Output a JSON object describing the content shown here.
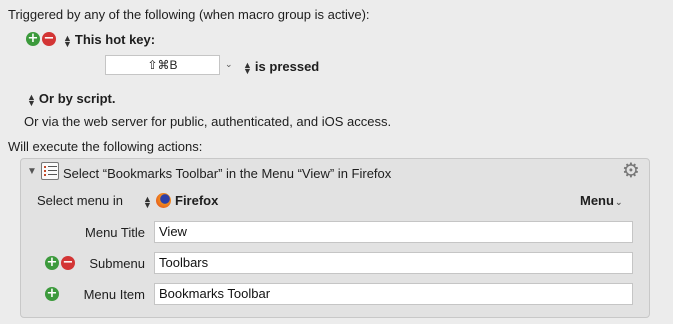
{
  "trigger": {
    "heading": "Triggered by any of the following (when macro group is active):",
    "hotkey_label": "This hot key:",
    "hotkey_value": "⇧⌘B",
    "hotkey_state": "is pressed",
    "script_label": "Or by script.",
    "web_server_text": "Or via the web server for public, authenticated, and iOS access."
  },
  "actions": {
    "heading": "Will execute the following actions:",
    "action_title": "Select “Bookmarks Toolbar” in the Menu “View” in Firefox",
    "select_menu_label": "Select menu in",
    "app_name": "Firefox",
    "menu_button": "Menu",
    "fields": {
      "menu_title_label": "Menu Title",
      "menu_title_value": "View",
      "submenu_label": "Submenu",
      "submenu_value": "Toolbars",
      "menu_item_label": "Menu Item",
      "menu_item_value": "Bookmarks Toolbar"
    }
  },
  "icons": {
    "plus": "+",
    "minus": "−",
    "gear": "⚙",
    "disclosure": "▼",
    "chevron": "⌄",
    "updown_up": "▲",
    "updown_down": "▼"
  },
  "colors": {
    "plus_green": "#3c9a3c",
    "minus_red": "#d33535",
    "background": "#ececec"
  }
}
